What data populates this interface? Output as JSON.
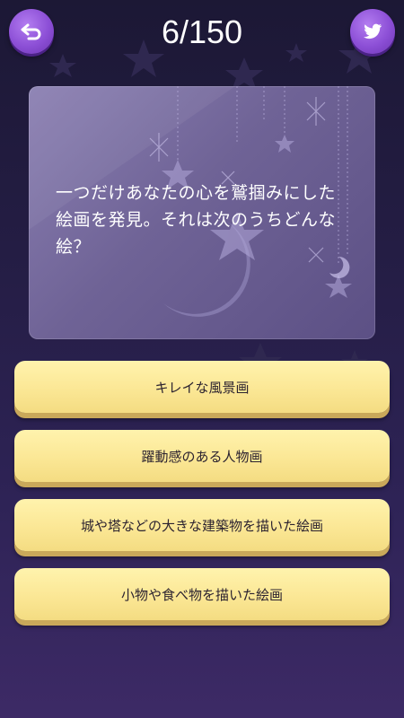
{
  "header": {
    "counter": "6/150",
    "back_icon": "back-arrow-icon",
    "share_icon": "twitter-bird-icon"
  },
  "question": {
    "text": "一つだけあなたの心を鷲掴みにした絵画を発見。それは次のうちどんな絵？"
  },
  "answers": [
    {
      "label": "キレイな風景画"
    },
    {
      "label": "躍動感のある人物画"
    },
    {
      "label": "城や塔などの大きな建築物を描いた絵画"
    },
    {
      "label": "小物や食べ物を描いた絵画"
    }
  ],
  "colors": {
    "background_top": "#1c1835",
    "background_bottom": "#3d2a66",
    "button_purple": "#8c4fd6",
    "answer_yellow": "#fbe795"
  }
}
